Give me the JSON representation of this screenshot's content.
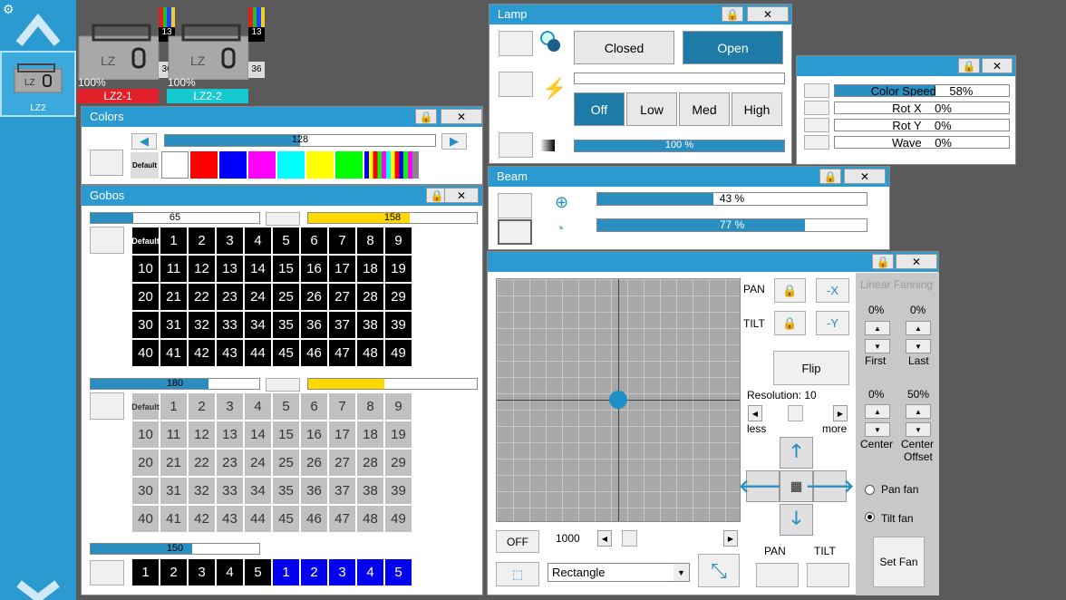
{
  "sidebar": {
    "fixture_label": "LZ2"
  },
  "fixtures": [
    {
      "name": "LZ2-1",
      "intensity": "100%",
      "channel": "13",
      "count": "36",
      "color": "#e0202a"
    },
    {
      "name": "LZ2-2",
      "intensity": "100%",
      "channel": "13",
      "count": "36",
      "color": "#17c9d0"
    }
  ],
  "colors": {
    "title": "Colors",
    "slider_value": "128",
    "default_label": "Default",
    "swatches": [
      "#ffffff",
      "#ff0000",
      "#0000ff",
      "#ff00ff",
      "#00ffff",
      "#ffff00",
      "#00ff00"
    ]
  },
  "gobos": {
    "title": "Gobos",
    "wheel1": {
      "slider": "65",
      "slider_fill": 0.25,
      "yellow": "158",
      "yellow_fill": 0.6
    },
    "wheel2": {
      "slider": "180",
      "slider_fill": 0.7,
      "yellow": "",
      "yellow_fill": 0.45
    },
    "wheel3": {
      "slider": "150",
      "slider_fill": 0.6
    },
    "default_label": "Default",
    "cells": [
      "1",
      "2",
      "3",
      "4",
      "5",
      "6",
      "7",
      "8",
      "9",
      "10",
      "11",
      "12",
      "13",
      "14",
      "15",
      "16",
      "17",
      "18",
      "19",
      "20",
      "21",
      "22",
      "23",
      "24",
      "25",
      "26",
      "27",
      "28",
      "29",
      "30",
      "31",
      "32",
      "33",
      "34",
      "35",
      "36",
      "37",
      "38",
      "39",
      "40",
      "41",
      "42",
      "43",
      "44",
      "45",
      "46",
      "47",
      "48",
      "49"
    ],
    "row3_black": [
      "1",
      "2",
      "3",
      "4",
      "5"
    ],
    "row3_blue": [
      "1",
      "2",
      "3",
      "4",
      "5"
    ]
  },
  "lamp": {
    "title": "Lamp",
    "closed": "Closed",
    "open": "Open",
    "off": "Off",
    "low": "Low",
    "med": "Med",
    "high": "High",
    "dimmer": "100 %",
    "dimmer_fill": 1.0
  },
  "effects": {
    "rows": [
      {
        "label": "Color Speed",
        "value": "58%",
        "fill": 0.58
      },
      {
        "label": "Rot X",
        "value": "0%",
        "fill": 0
      },
      {
        "label": "Rot Y",
        "value": "0%",
        "fill": 0
      },
      {
        "label": "Wave",
        "value": "0%",
        "fill": 0
      }
    ]
  },
  "beam": {
    "title": "Beam",
    "zoom": "43 %",
    "zoom_fill": 0.43,
    "focus": "77 %",
    "focus_fill": 0.77
  },
  "position": {
    "pan": "PAN",
    "tilt": "TILT",
    "minus_x": "-X",
    "minus_y": "-Y",
    "flip": "Flip",
    "resolution": "Resolution: 10",
    "less": "less",
    "more": "more",
    "off": "OFF",
    "speed": "1000",
    "shape": "Rectangle",
    "pan_btn": "PAN",
    "tilt_btn": "TILT",
    "fanning_title": "Linear Fanning",
    "first_val": "0%",
    "last_val": "0%",
    "first": "First",
    "last": "Last",
    "center_val": "0%",
    "offset_val": "50%",
    "center": "Center",
    "center_offset_1": "Center",
    "center_offset_2": "Offset",
    "pan_fan": "Pan fan",
    "tilt_fan": "Tilt fan",
    "set_fan": "Set Fan"
  }
}
